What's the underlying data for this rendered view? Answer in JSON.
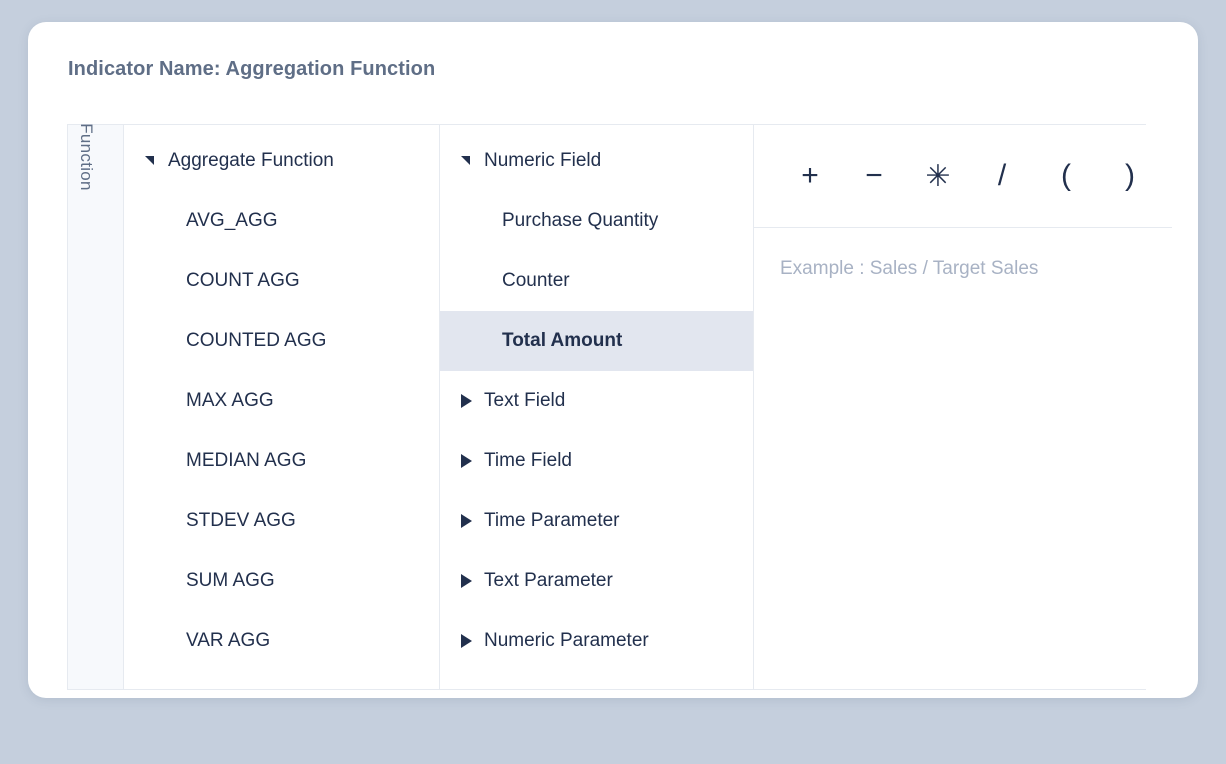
{
  "page": {
    "title": "Indicator Name: Aggregation Function",
    "background_color": "#c5cfdd",
    "card_color": "#ffffff"
  },
  "table": {
    "row_label": "Function",
    "functions": {
      "group": {
        "label": "Aggregate Function",
        "expanded": true,
        "marker_icon": "triangle-down-icon"
      },
      "items": [
        {
          "label": "AVG_AGG"
        },
        {
          "label": "COUNT AGG"
        },
        {
          "label": "COUNTED AGG"
        },
        {
          "label": "MAX AGG"
        },
        {
          "label": "MEDIAN AGG"
        },
        {
          "label": "STDEV AGG"
        },
        {
          "label": "SUM AGG"
        },
        {
          "label": "VAR AGG"
        }
      ]
    },
    "fields": {
      "group": {
        "label": "Numeric Field",
        "expanded": true,
        "marker_icon": "triangle-down-icon"
      },
      "items": [
        {
          "label": "Purchase Quantity",
          "selected": false
        },
        {
          "label": "Counter",
          "selected": false
        },
        {
          "label": "Total Amount",
          "selected": true
        }
      ],
      "collapsed_groups": [
        {
          "label": "Text Field",
          "marker_icon": "triangle-right-icon"
        },
        {
          "label": "Time Field",
          "marker_icon": "triangle-right-icon"
        },
        {
          "label": "Time Parameter",
          "marker_icon": "triangle-right-icon"
        },
        {
          "label": "Text Parameter",
          "marker_icon": "triangle-right-icon"
        },
        {
          "label": "Numeric Parameter",
          "marker_icon": "triangle-right-icon"
        }
      ],
      "selected_highlight_color": "#e2e6ef"
    },
    "editor": {
      "operators": [
        {
          "label": "+",
          "icon": "plus-operator-icon"
        },
        {
          "label": "−",
          "icon": "minus-operator-icon"
        },
        {
          "label": "✳",
          "icon": "asterisk-operator-icon"
        },
        {
          "label": "/",
          "icon": "divide-operator-icon"
        },
        {
          "label": "(",
          "icon": "left-paren-operator-icon"
        },
        {
          "label": ")",
          "icon": "right-paren-operator-icon"
        }
      ],
      "expression_value": "",
      "expression_placeholder": "Example : Sales / Target Sales"
    }
  }
}
